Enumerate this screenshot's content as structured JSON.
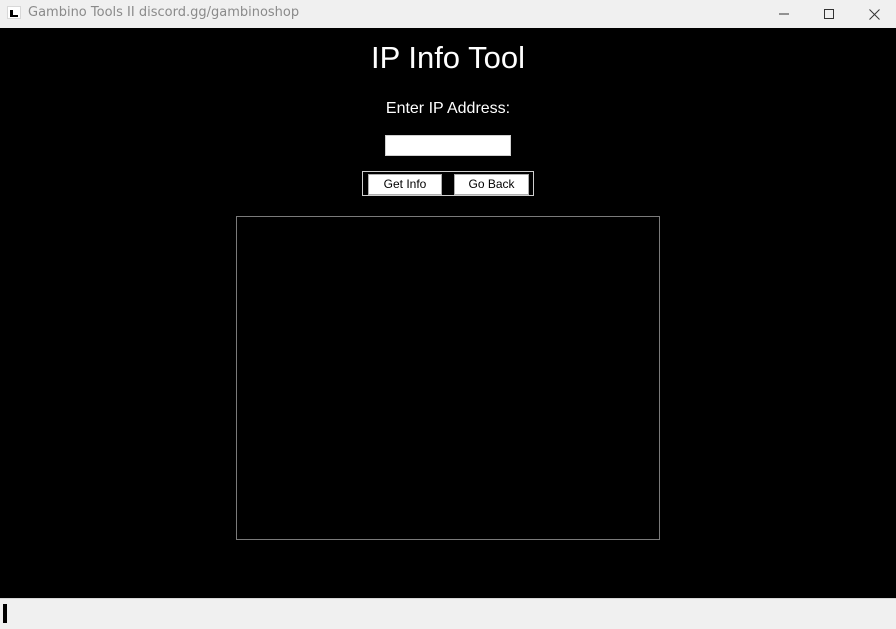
{
  "window": {
    "title": "Gambino Tools II discord.gg/gambinoshop",
    "icon": "app-icon",
    "controls": [
      "minimize-icon",
      "maximize-icon",
      "close-icon"
    ]
  },
  "main": {
    "title": "IP Info Tool",
    "ip_label": "Enter IP Address:",
    "ip_input": {
      "value": "",
      "placeholder": ""
    },
    "buttons": {
      "get_info": "Get Info",
      "go_back": "Go Back"
    },
    "output_text": ""
  },
  "colors": {
    "background": "#000000",
    "text": "#ffffff",
    "titlebar": "#f0f0f0"
  }
}
